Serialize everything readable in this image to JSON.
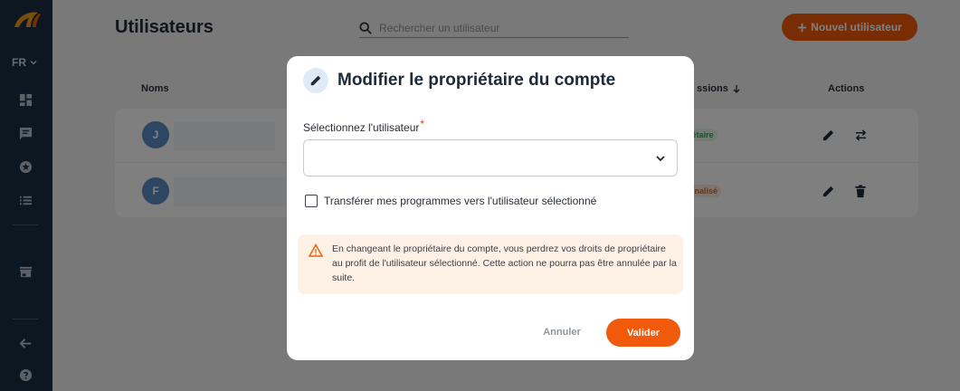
{
  "sidebar": {
    "logo": "logo",
    "language": "FR",
    "icons": [
      "dashboard-icon",
      "chat-icon",
      "star-icon",
      "list-icon",
      "store-icon",
      "arrow-left-icon",
      "help-icon"
    ]
  },
  "page": {
    "title": "Utilisateurs",
    "search_placeholder": "Rechercher un utilisateur",
    "new_user_label": "Nouvel utilisateur",
    "columns": {
      "names": "Noms",
      "permissions": "ssions",
      "actions": "Actions"
    },
    "rows": [
      {
        "initial": "J",
        "badge": "iétaire"
      },
      {
        "initial": "F",
        "badge": "nnalisé"
      }
    ]
  },
  "modal": {
    "title": "Modifier le propriétaire du compte",
    "field_label": "Sélectionnez l'utilisateur",
    "required_mark": "*",
    "select_value": "",
    "checkbox_label": "Transférer mes programmes vers l'utilisateur sélectionné",
    "checkbox_checked": false,
    "warning": "En changeant le propriétaire du compte, vous perdrez vos droits de propriétaire au profit de l'utilisateur sélectionné. Cette action ne pourra pas être annulée par la suite.",
    "cancel_label": "Annuler",
    "confirm_label": "Valider"
  },
  "colors": {
    "accent": "#f05a0a",
    "sidebar": "#1b2f45",
    "warning_bg": "#fdf1e6",
    "warning_icon": "#e8660b"
  }
}
